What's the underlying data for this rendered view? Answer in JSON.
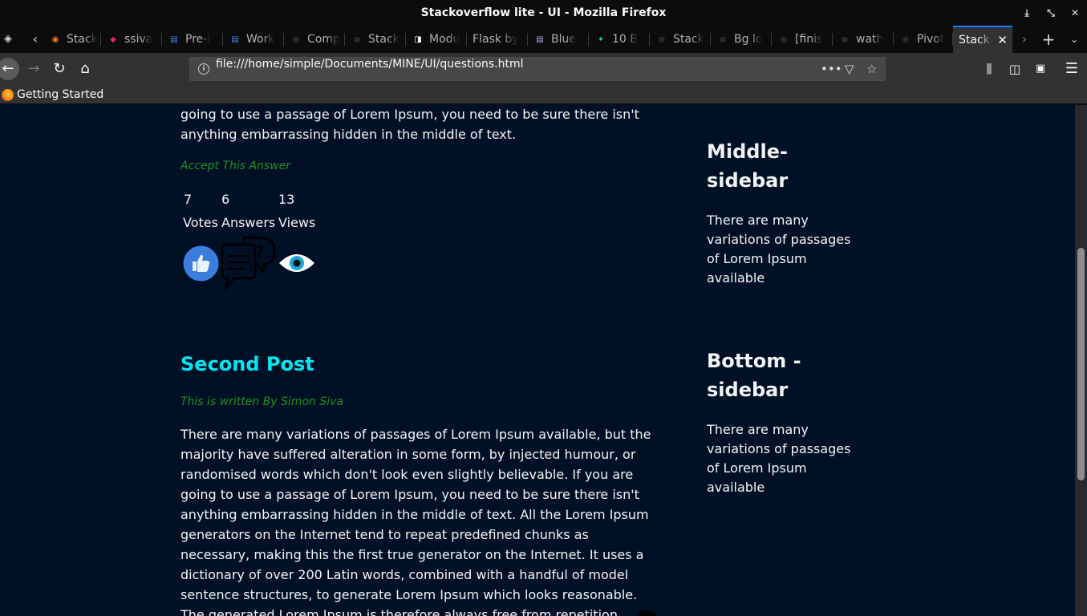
{
  "window": {
    "title": "Stackoverflow lite - UI - Mozilla Firefox",
    "controls": [
      "⤓",
      "⤡",
      "✕"
    ]
  },
  "tabs": [
    {
      "label": "Stack",
      "icon": "stackoverflow-icon",
      "color": "#f48024"
    },
    {
      "label": "ssiva",
      "icon": "ruby-gem-icon",
      "color": "#e0245e"
    },
    {
      "label": "Pre-l",
      "icon": "docs-icon",
      "color": "#4285f4"
    },
    {
      "label": "Work",
      "icon": "docs-icon",
      "color": "#4285f4"
    },
    {
      "label": "Comp",
      "icon": "github-icon",
      "color": "#24292e"
    },
    {
      "label": "Stack",
      "icon": "github-icon",
      "color": "#24292e"
    },
    {
      "label": "Modu",
      "icon": "page-icon",
      "color": "#ffffff"
    },
    {
      "label": "Flask by",
      "icon": "",
      "color": ""
    },
    {
      "label": "Blue",
      "icon": "docs-icon",
      "color": "#9fb4cf"
    },
    {
      "label": "10 B",
      "icon": "lightbulb-icon",
      "color": "#1ec8b4"
    },
    {
      "label": "Stack",
      "icon": "github-icon",
      "color": "#24292e"
    },
    {
      "label": "Bg lo",
      "icon": "github-icon",
      "color": "#24292e"
    },
    {
      "label": "[finis",
      "icon": "github-icon",
      "color": "#24292e"
    },
    {
      "label": "wath",
      "icon": "github-icon",
      "color": "#24292e"
    },
    {
      "label": "Pivot",
      "icon": "github-icon",
      "color": "#24292e"
    },
    {
      "label": "Stack",
      "icon": "",
      "color": "",
      "active": true
    }
  ],
  "nav": {
    "url": "file:///home/simple/Documents/MINE/UI/questions.html"
  },
  "bookmarks": [
    {
      "label": "Getting Started"
    }
  ],
  "post1": {
    "text_tail": "going to use a passage of Lorem Ipsum, you need to be sure there isn't anything embarrassing hidden in the middle of text.",
    "accept_label": "Accept This Answer",
    "stats": {
      "votes": {
        "value": "7",
        "label": "Votes"
      },
      "answers": {
        "value": "6",
        "label": "Answers"
      },
      "views": {
        "value": "13",
        "label": "Views"
      }
    }
  },
  "post2": {
    "title": "Second Post",
    "byline": "This is written By Simon Siva",
    "body": "There are many variations of passages of Lorem Ipsum available, but the majority have suffered alteration in some form, by injected humour, or randomised words which don't look even slightly believable. If you are going to use a passage of Lorem Ipsum, you need to be sure there isn't anything embarrassing hidden in the middle of text. All the Lorem Ipsum generators on the Internet tend to repeat predefined chunks as necessary, making this the first true generator on the Internet. It uses a dictionary of over 200 Latin words, combined with a handful of model sentence structures, to generate Lorem Ipsum which looks reasonable. The generated Lorem Ipsum is therefore always free from repetition"
  },
  "sidebar": {
    "middle": {
      "title": "Middle-sidebar",
      "text": "There are many variations of passages of Lorem Ipsum available"
    },
    "bottom": {
      "title": "Bottom -sidebar",
      "text": "There are many variations of passages of Lorem Ipsum available"
    }
  },
  "colors": {
    "page_bg": "#001126",
    "title_cyan": "#00e6f0",
    "byline_green": "#1e8f1e"
  }
}
